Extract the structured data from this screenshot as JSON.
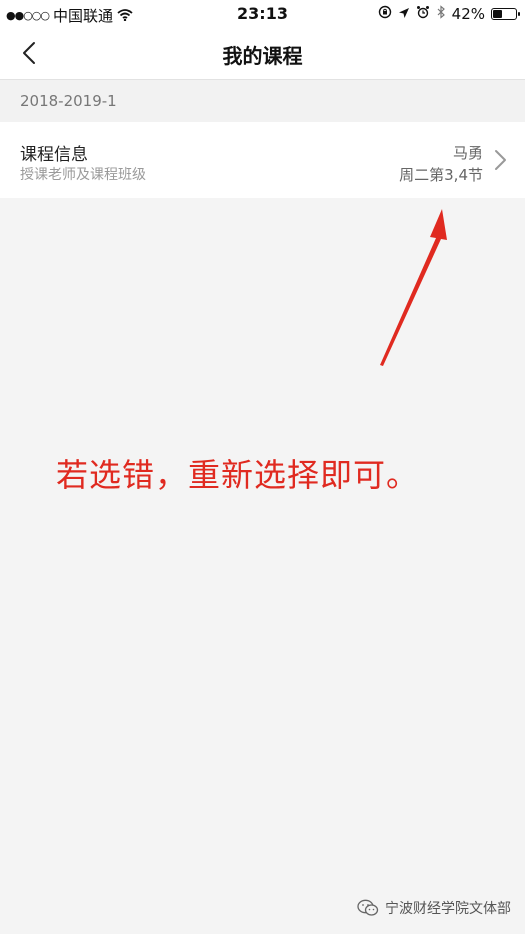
{
  "status_bar": {
    "signal": "●●○○○",
    "carrier": "中国联通",
    "time": "23:13",
    "battery": "42%",
    "battery_level": 0.42
  },
  "nav": {
    "title": "我的课程"
  },
  "term": {
    "label": "2018-2019-1"
  },
  "course": {
    "title": "课程信息",
    "subtitle": "授课老师及课程班级",
    "teacher": "马勇",
    "time": "周二第3,4节"
  },
  "annotation": {
    "text": "若选错，重新选择即可。",
    "color": "#e02a20"
  },
  "watermark": {
    "text": "宁波财经学院文体部"
  }
}
